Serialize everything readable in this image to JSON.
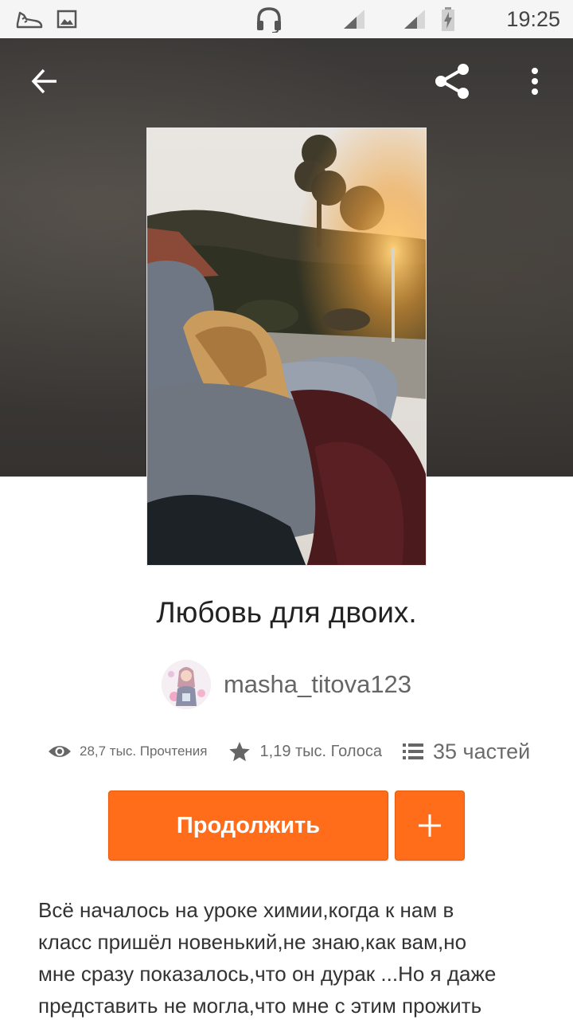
{
  "status_bar": {
    "time": "19:25"
  },
  "header": {
    "back_icon": "arrow-left-icon",
    "share_icon": "share-icon",
    "more_icon": "more-vertical-icon"
  },
  "story": {
    "title": "Любовь для двоих.",
    "author": "masha_titova123",
    "stats": {
      "reads": "28,7 тыс. Прочтения",
      "votes": "1,19 тыс. Голоса",
      "parts": "35 частей"
    },
    "description_lines": [
      "Всё началось на уроке химии,когда к нам в",
      "класс пришёл новенький,не знаю,как вам,но",
      "мне сразу показалось,что он дурак ...Но я даже",
      "представить не могла,что мне с этим  прожить"
    ]
  },
  "actions": {
    "continue_label": "Продолжить",
    "add_icon": "plus-icon"
  },
  "colors": {
    "accent": "#ff6d1a",
    "header_bg": "#3f3c39"
  }
}
